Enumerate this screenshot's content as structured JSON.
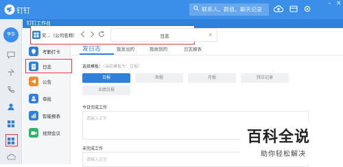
{
  "app": {
    "name": "钉钉",
    "brand_color": "#3c8fe8"
  },
  "topbar": {
    "search_placeholder": "联系人、群组、聊天记录",
    "user_initials": "李莎"
  },
  "workbench": {
    "title": "钉钉工作台"
  },
  "browser": {
    "crumb": "实...（公司名称）",
    "tab_label": "日志",
    "close": "×"
  },
  "nav": [
    {
      "label": "考勤打卡",
      "color": "#2f80d8"
    },
    {
      "label": "日志",
      "color": "#2f80d8"
    },
    {
      "label": "公告",
      "color": "#ef8b2c"
    },
    {
      "label": "审批",
      "color": "#2f80d8"
    },
    {
      "label": "智能报表",
      "color": "#2f80d8"
    },
    {
      "label": "视频会议",
      "color": "#30b36b"
    }
  ],
  "tabs": [
    "发日志",
    "我发出的",
    "我收到的",
    "日志报表"
  ],
  "template": {
    "label": "选择模板：",
    "hint": "（当前模板为：日报）",
    "buttons": [
      "日报",
      "周报",
      "月报",
      "拜访记录",
      "业绩日报"
    ]
  },
  "today": {
    "label": "今日完成工作",
    "placeholder": "请输入文字"
  },
  "pending": {
    "label": "未完成工作",
    "placeholder": "请输入文字"
  },
  "watermark": {
    "title": "百科全说",
    "subtitle": "助你轻松解决"
  }
}
